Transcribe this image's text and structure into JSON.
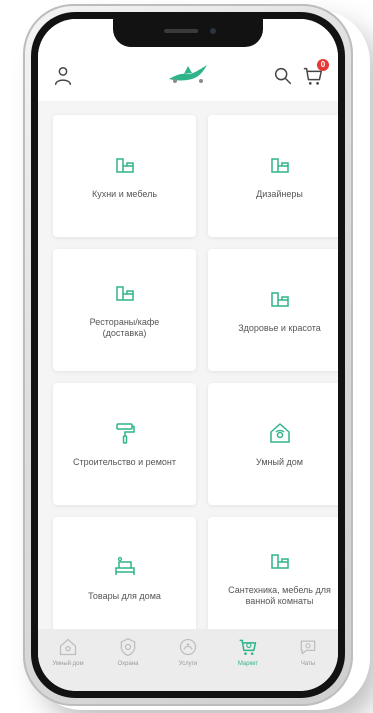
{
  "colors": {
    "accent": "#2fb38a",
    "badge": "#e53935",
    "tab_inactive": "#9a9a9a"
  },
  "header": {
    "left_icon": "user-icon",
    "logo_icon": "bird-logo",
    "search_icon": "search-icon",
    "cart_icon": "cart-icon",
    "cart_badge": "0"
  },
  "categories": [
    {
      "label": "Кухни и мебель",
      "icon": "sofa-icon"
    },
    {
      "label": "Дизайнеры",
      "icon": "sofa-icon"
    },
    {
      "label": "Рестораны/кафе\n(доставка)",
      "icon": "sofa-icon"
    },
    {
      "label": "Здоровье и красота",
      "icon": "sofa-icon"
    },
    {
      "label": "Строительство и ремонт",
      "icon": "paint-roller-icon"
    },
    {
      "label": "Умный дом",
      "icon": "smart-home-icon"
    },
    {
      "label": "Товары для дома",
      "icon": "furniture-icon"
    },
    {
      "label": "Сантехника, мебель для\nванной комнаты",
      "icon": "sofa-icon"
    }
  ],
  "tabbar": {
    "items": [
      {
        "label": "Умный дом",
        "icon": "home-icon",
        "active": false
      },
      {
        "label": "Охрана",
        "icon": "shield-icon",
        "active": false
      },
      {
        "label": "Услуги",
        "icon": "services-icon",
        "active": false
      },
      {
        "label": "Маркет",
        "icon": "market-cart-icon",
        "active": true
      },
      {
        "label": "Чаты",
        "icon": "chat-icon",
        "active": false
      }
    ]
  }
}
